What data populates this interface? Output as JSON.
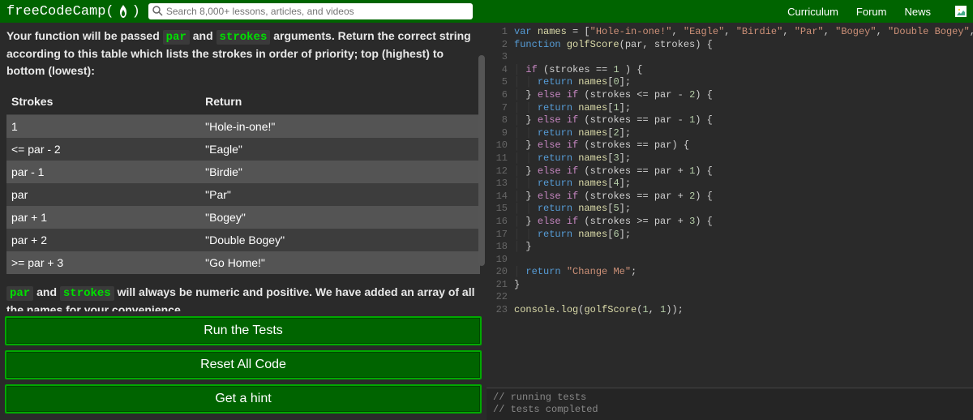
{
  "topbar": {
    "logo_text": "freeCodeCamp(",
    "logo_suffix": ")",
    "search_placeholder": "Search 8,000+ lessons, articles, and videos",
    "nav": {
      "curriculum": "Curriculum",
      "forum": "Forum",
      "news": "News"
    }
  },
  "left": {
    "intro_pre": "Your function will be passed ",
    "intro_code1": "par",
    "intro_mid1": " and ",
    "intro_code2": "strokes",
    "intro_post": " arguments. Return the correct string according to this table which lists the strokes in order of priority; top (highest) to bottom (lowest):",
    "table": {
      "headers": {
        "strokes": "Strokes",
        "ret": "Return"
      },
      "rows": [
        {
          "s": "1",
          "r": "\"Hole-in-one!\""
        },
        {
          "s": "<= par - 2",
          "r": "\"Eagle\""
        },
        {
          "s": "par - 1",
          "r": "\"Birdie\""
        },
        {
          "s": "par",
          "r": "\"Par\""
        },
        {
          "s": "par + 1",
          "r": "\"Bogey\""
        },
        {
          "s": "par + 2",
          "r": "\"Double Bogey\""
        },
        {
          "s": ">= par + 3",
          "r": "\"Go Home!\""
        }
      ]
    },
    "foot_code1": "par",
    "foot_mid1": " and ",
    "foot_code2": "strokes",
    "foot_post": " will always be numeric and positive. We have added an array of all the names for your convenience.",
    "buttons": {
      "run": "Run the Tests",
      "reset": "Reset All Code",
      "hint": "Get a hint"
    }
  },
  "editor": {
    "lines": [
      "var names = [\"Hole-in-one!\", \"Eagle\", \"Birdie\", \"Par\", \"Bogey\", \"Double Bogey\", \"Go Home!\"];",
      "function golfScore(par, strokes) {",
      "",
      "  if (strokes == 1 ) {",
      "    return names[0];",
      "  } else if (strokes <= par - 2) {",
      "    return names[1];",
      "  } else if (strokes == par - 1) {",
      "    return names[2];",
      "  } else if (strokes == par) {",
      "    return names[3];",
      "  } else if (strokes == par + 1) {",
      "    return names[4];",
      "  } else if (strokes == par + 2) {",
      "    return names[5];",
      "  } else if (strokes >= par + 3) {",
      "    return names[6];",
      "  }",
      "",
      "  return \"Change Me\";",
      "}",
      "",
      "console.log(golfScore(1, 1));"
    ]
  },
  "console": {
    "l1": "// running tests",
    "l2": "// tests completed"
  }
}
